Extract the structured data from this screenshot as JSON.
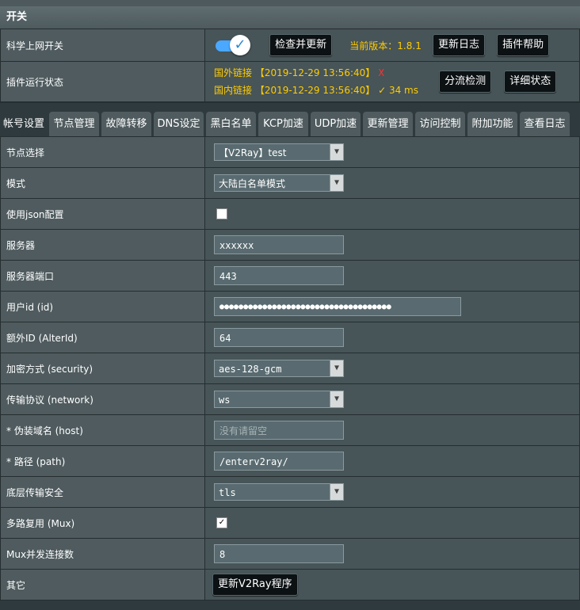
{
  "section_title": "开关",
  "switch_row": {
    "label": "科学上网开关",
    "check_update": "检查并更新",
    "version": "当前版本：1.8.1",
    "changelog": "更新日志",
    "plugin_help": "插件帮助"
  },
  "status_row": {
    "label": "插件运行状态",
    "foreign": "国外链接 【2019-12-29 13:56:40】",
    "foreign_mark": "X",
    "domestic": "国内链接 【2019-12-29 13:56:40】 ✓  34 ms",
    "split_check": "分流检测",
    "detail_status": "详细状态"
  },
  "tabs": [
    "帐号设置",
    "节点管理",
    "故障转移",
    "DNS设定",
    "黑白名单",
    "KCP加速",
    "UDP加速",
    "更新管理",
    "访问控制",
    "附加功能",
    "查看日志"
  ],
  "form": {
    "node_label": "节点选择",
    "node_value": "【V2Ray】test",
    "mode_label": "模式",
    "mode_value": "大陆白名单模式",
    "json_label": "使用json配置",
    "server_label": "服务器",
    "server_value": "xxxxxx",
    "port_label": "服务器端口",
    "port_value": "443",
    "uid_label": "用户id (id)",
    "uid_value": "●●●●●●●●●●●●●●●●●●●●●●●●●●●●●●●●●●●●",
    "alterid_label": "额外ID (AlterId)",
    "alterid_value": "64",
    "security_label": "加密方式 (security)",
    "security_value": "aes-128-gcm",
    "network_label": "传输协议 (network)",
    "network_value": "ws",
    "host_label": "* 伪装域名 (host)",
    "host_placeholder": "没有请留空",
    "path_label": "* 路径 (path)",
    "path_value": "/enterv2ray/",
    "tls_label": "底层传输安全",
    "tls_value": "tls",
    "mux_label": "多路复用 (Mux)",
    "muxconn_label": "Mux并发连接数",
    "muxconn_value": "8",
    "other_label": "其它",
    "update_v2ray": "更新V2Ray程序"
  },
  "states": {
    "switch_on": true,
    "json_checked": false,
    "mux_checked": true
  },
  "colors": {
    "accent": "#4aa8ff",
    "status_yellow": "#ffcc00",
    "fail_red": "#ff3030"
  }
}
